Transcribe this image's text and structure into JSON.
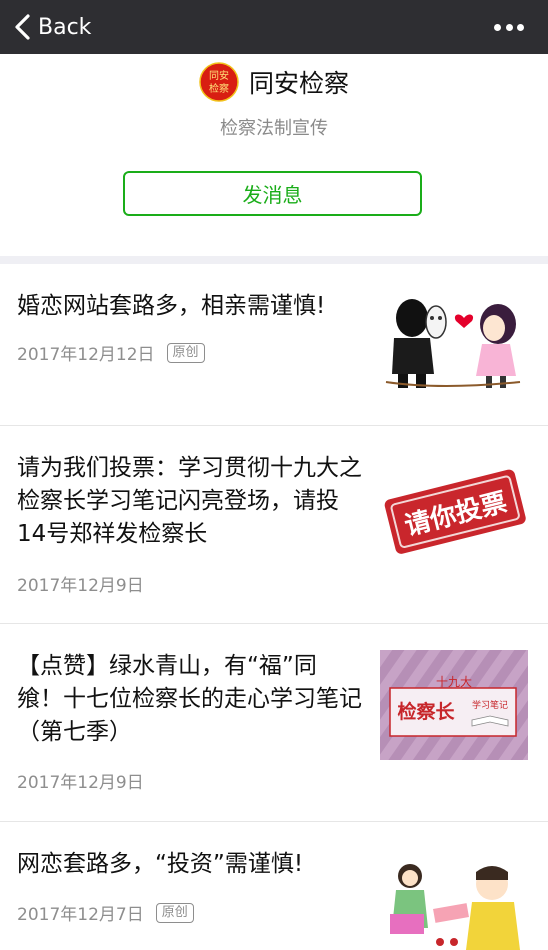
{
  "topbar": {
    "back_label": "Back"
  },
  "profile": {
    "logo_text_line1": "同安",
    "logo_text_line2": "检察",
    "name": "同安检察",
    "description": "检察法制宣传",
    "message_button": "发消息"
  },
  "articles": [
    {
      "title": "婚恋网站套路多，相亲需谨慎!",
      "date": "2017年12月12日",
      "badge": "原创"
    },
    {
      "title": "请为我们投票：学习贯彻十九大之检察长学习笔记闪亮登场，请投14号郑祥发检察长",
      "date": "2017年12月9日",
      "thumb_text": "请你投票"
    },
    {
      "title": "【点赞】绿水青山，有“福”同飨！十七位检察长的走心学习笔记（第七季）",
      "date": "2017年12月9日",
      "thumb_line1": "十九大",
      "thumb_main": "检察长",
      "thumb_sub": "学习笔记"
    },
    {
      "title": "网恋套路多，“投资”需谨慎!",
      "date": "2017年12月7日",
      "badge": "原创"
    }
  ],
  "colors": {
    "topbar": "#2e2e32",
    "accent_green": "#1aad19",
    "separator": "#efeff4"
  }
}
